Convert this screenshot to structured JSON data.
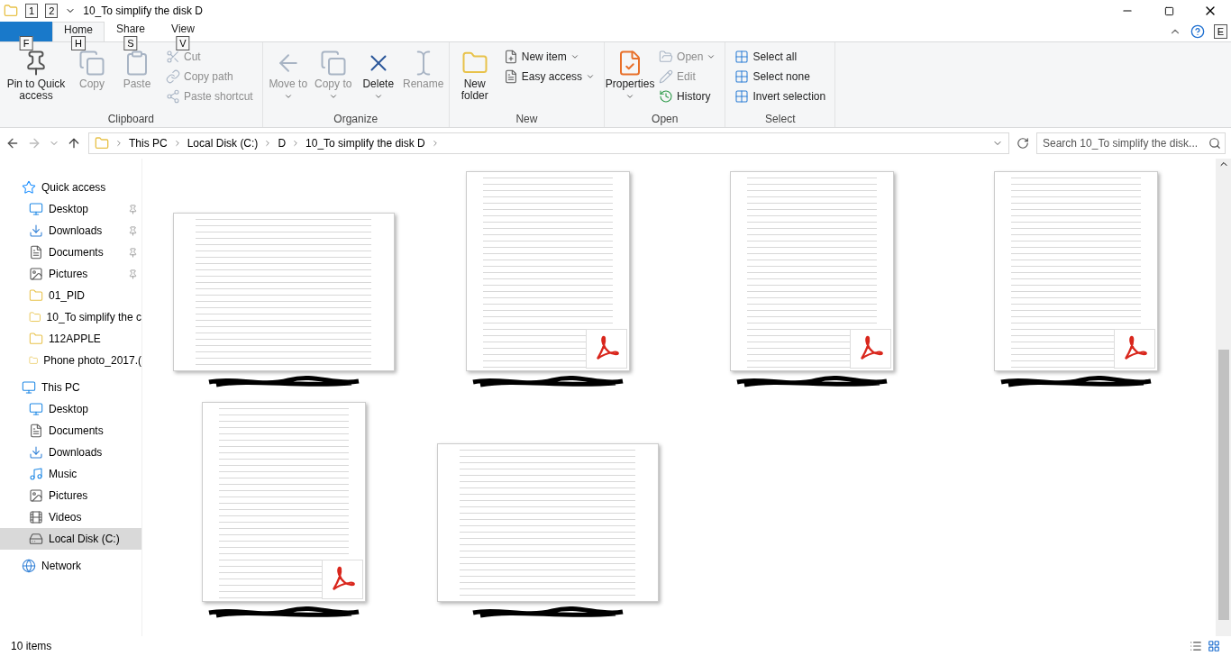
{
  "window": {
    "title": "10_To simplify the disk D",
    "quick_access_keytips": [
      "1",
      "2"
    ]
  },
  "tabs": [
    {
      "keytip": "F",
      "kind": "file",
      "selected": false
    },
    {
      "label": "Home",
      "keytip": "H",
      "kind": "tab",
      "selected": true
    },
    {
      "label": "Share",
      "keytip": "S",
      "kind": "tab",
      "selected": false
    },
    {
      "label": "View",
      "keytip": "V",
      "kind": "tab",
      "selected": false
    }
  ],
  "help_keytip": "E",
  "ribbon": [
    {
      "name": "Clipboard",
      "items": [
        {
          "label": "Pin to Quick access",
          "kind": "large",
          "disabled": false,
          "dropdown": false
        },
        {
          "label": "Copy",
          "kind": "large",
          "disabled": true,
          "dropdown": false
        },
        {
          "label": "Paste",
          "kind": "large",
          "disabled": true,
          "dropdown": false
        },
        {
          "kind": "stack",
          "items": [
            {
              "label": "Cut",
              "disabled": true,
              "dropdown": false
            },
            {
              "label": "Copy path",
              "disabled": true,
              "dropdown": false
            },
            {
              "label": "Paste shortcut",
              "disabled": true,
              "dropdown": false
            }
          ]
        }
      ]
    },
    {
      "name": "Organize",
      "items": [
        {
          "label": "Move to",
          "kind": "large",
          "disabled": true,
          "dropdown": true
        },
        {
          "label": "Copy to",
          "kind": "large",
          "disabled": true,
          "dropdown": true
        },
        {
          "label": "Delete",
          "kind": "large",
          "disabled": false,
          "dropdown": true
        },
        {
          "label": "Rename",
          "kind": "large",
          "disabled": true,
          "dropdown": false
        }
      ]
    },
    {
      "name": "New",
      "items": [
        {
          "label": "New folder",
          "kind": "large",
          "disabled": false,
          "dropdown": false
        },
        {
          "kind": "stack",
          "items": [
            {
              "label": "New item",
              "disabled": false,
              "dropdown": true
            },
            {
              "label": "Easy access",
              "disabled": false,
              "dropdown": true
            }
          ]
        }
      ]
    },
    {
      "name": "Open",
      "items": [
        {
          "label": "Properties",
          "kind": "large",
          "disabled": false,
          "dropdown": true
        },
        {
          "kind": "stack",
          "items": [
            {
              "label": "Open",
              "disabled": true,
              "dropdown": true
            },
            {
              "label": "Edit",
              "disabled": true,
              "dropdown": false
            },
            {
              "label": "History",
              "disabled": false,
              "dropdown": false
            }
          ]
        }
      ]
    },
    {
      "name": "Select",
      "items": [
        {
          "kind": "stack",
          "items": [
            {
              "label": "Select all",
              "disabled": false,
              "dropdown": false
            },
            {
              "label": "Select none",
              "disabled": false,
              "dropdown": false
            },
            {
              "label": "Invert selection",
              "disabled": false,
              "dropdown": false
            }
          ]
        }
      ]
    }
  ],
  "address": {
    "path": [
      "This PC",
      "Local Disk (C:)",
      "D",
      "10_To simplify the disk D"
    ],
    "search_placeholder": "Search 10_To simplify the disk..."
  },
  "sidebar": [
    {
      "label": "Quick access",
      "selected": false,
      "children": [
        {
          "label": "Desktop",
          "pinned": true,
          "selected": false
        },
        {
          "label": "Downloads",
          "pinned": true,
          "selected": false
        },
        {
          "label": "Documents",
          "pinned": true,
          "selected": false
        },
        {
          "label": "Pictures",
          "pinned": true,
          "selected": false
        },
        {
          "label": "01_PID",
          "pinned": false,
          "selected": false
        },
        {
          "label": "10_To simplify the c",
          "pinned": false,
          "selected": false
        },
        {
          "label": "112APPLE",
          "pinned": false,
          "selected": false
        },
        {
          "label": "Phone photo_2017.(",
          "pinned": false,
          "selected": false
        }
      ]
    },
    {
      "label": "This PC",
      "selected": false,
      "children": [
        {
          "label": "Desktop",
          "pinned": false,
          "selected": false
        },
        {
          "label": "Documents",
          "pinned": false,
          "selected": false
        },
        {
          "label": "Downloads",
          "pinned": false,
          "selected": false
        },
        {
          "label": "Music",
          "pinned": false,
          "selected": false
        },
        {
          "label": "Pictures",
          "pinned": false,
          "selected": false
        },
        {
          "label": "Videos",
          "pinned": false,
          "selected": false
        },
        {
          "label": "Local Disk (C:)",
          "pinned": false,
          "selected": true
        }
      ]
    },
    {
      "label": "Network",
      "selected": false
    }
  ],
  "files": [
    {
      "kind": "landscape",
      "pdf_badge": false
    },
    {
      "kind": "portrait",
      "pdf_badge": true
    },
    {
      "kind": "portrait",
      "pdf_badge": true
    },
    {
      "kind": "portrait",
      "pdf_badge": true
    },
    {
      "kind": "portrait",
      "pdf_badge": true
    },
    {
      "kind": "landscape",
      "pdf_badge": false
    }
  ],
  "status_bar": {
    "count": "10 items"
  }
}
